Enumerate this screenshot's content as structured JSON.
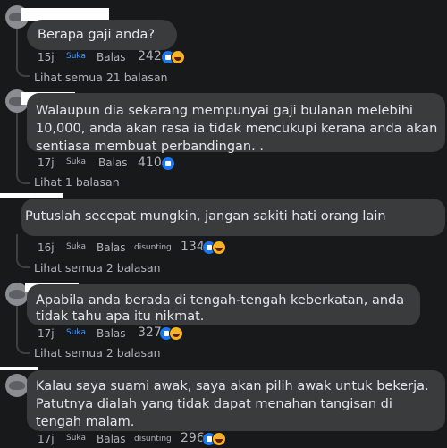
{
  "comments": [
    {
      "lines": [
        "Berapa gaji anda?"
      ],
      "time": "15j",
      "like_label": "Suka",
      "reply_label": "Balas",
      "edited": "",
      "reaction_count": "242",
      "reactions": [
        "like",
        "haha"
      ],
      "like_active": true,
      "view_replies": "Lihat semua 21 balasan"
    },
    {
      "lines": [
        "Walaupun dia sekarang mempunyai gaji bulanan melebihi",
        "10,000, anda akan rasa ia tidak mencukupi kerana anda akan",
        "sentiasa membuat perbandingan. ."
      ],
      "time": "17j",
      "like_label": "Suka",
      "reply_label": "Balas",
      "edited": "",
      "reaction_count": "410",
      "reactions": [
        "like"
      ],
      "like_active": false,
      "view_replies": "Lihat 1 balasan"
    },
    {
      "lines": [
        "Putuslah secepat mungkin, jangan sakiti hati orang lain"
      ],
      "time": "16j",
      "like_label": "Suka",
      "reply_label": "Balas",
      "edited": "disunting",
      "reaction_count": "134",
      "reactions": [
        "like",
        "haha"
      ],
      "like_active": false,
      "view_replies": "Lihat semua 2 balasan"
    },
    {
      "lines": [
        "Apabila anda berada di tengah-tengah keberkatan, anda",
        "tidak tahu apa itu nikmat."
      ],
      "time": "17j",
      "like_label": "Suka",
      "reply_label": "Balas",
      "edited": "",
      "reaction_count": "327",
      "reactions": [
        "like",
        "haha"
      ],
      "like_active": true,
      "view_replies": "Lihat semua 2 balasan"
    },
    {
      "lines": [
        "Kalau saya suami awak, saya akan pilih awak untuk bekerja.",
        "Patutnya dialah yang tidak dapat menahan tangisan di",
        "tengah malam."
      ],
      "time": "17j",
      "like_label": "Suka",
      "reply_label": "Balas",
      "edited": "disunting",
      "reaction_count": "296",
      "reactions": [
        "like",
        "haha"
      ],
      "like_active": false,
      "view_replies": ""
    }
  ],
  "colors": {
    "background": "#18191a",
    "bubble": "#3a3b3c",
    "text": "#e4e6eb",
    "meta": "#b0b3b8",
    "active_like": "#4599ff"
  }
}
